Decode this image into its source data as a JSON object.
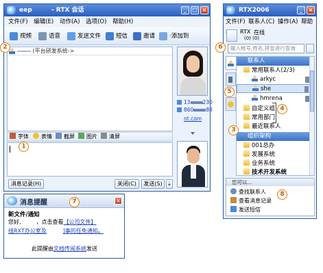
{
  "chat_window": {
    "title_prefix": "eep",
    "title_suffix": "- RTX 会话",
    "menu": [
      "文件(F)",
      "编辑(E)",
      "动作(A)",
      "选项(O)",
      "帮助(H)"
    ],
    "toolbar": [
      "视频",
      "语音",
      "发送文件",
      "短信",
      "邀请",
      "·添加到"
    ],
    "session_label": "(平台研发系统->",
    "format_bar": [
      "字体",
      "表情",
      "截屏",
      "图片",
      "清屏"
    ],
    "history_button": "消息记录(H)",
    "close_button": "关闭(C)",
    "send_button": "发送(S)",
    "send_arrow": "⇣",
    "contact_phone_1": "13",
    "contact_phone_1_tail": "230",
    "contact_phone_2": "860",
    "contact_phone_2_tail": "88",
    "contact_link": "nt.com"
  },
  "rtx_window": {
    "title": "RTX2006",
    "menu": [
      "文件(F)",
      "联系人(C)",
      "操作(A)",
      "帮助(H)"
    ],
    "account_name": "RTX",
    "status": "在线",
    "counters": "(0)  (0)",
    "search_placeholder": "输入帐号,姓名,拼音进行查询",
    "contacts_header": "联系人",
    "contacts": [
      {
        "label": "常用联系人(2/3)",
        "type": "folder",
        "indent": 0
      },
      {
        "label": "arkyc",
        "type": "person",
        "indent": 1
      },
      {
        "label": "she",
        "type": "person",
        "indent": 1,
        "selected": true
      },
      {
        "label": "hmrena",
        "type": "person",
        "indent": 1
      }
    ],
    "groups": [
      "自定义组",
      "常用部门",
      "最近联系人"
    ],
    "org_header": "组织架构",
    "org_items": [
      "001总办",
      "发展系统",
      "业务系统",
      "技术开发系统"
    ],
    "you_can": "您可以...",
    "actions": [
      "查找联系人",
      "查看消息记录",
      "发送短信"
    ]
  },
  "notification": {
    "title": "消息提醒",
    "heading": "新文件/通知",
    "greeting": "您好,",
    "line1_mid": "，点击查看",
    "line1_link": "【公司文件】",
    "line2_prefix": "线RXT办公室及",
    "line2_suffix": "]事的任免通知",
    "line2_end": "。",
    "footer_prefix": "此提醒由",
    "footer_link": "文档传阅系统",
    "footer_suffix": "发送"
  },
  "callouts": [
    "1",
    "2",
    "3",
    "4",
    "5",
    "6",
    "7",
    "8"
  ],
  "colors": {
    "accent": "#2a5ec2",
    "callout": "#e07b00",
    "link": "#1a3fb8"
  }
}
